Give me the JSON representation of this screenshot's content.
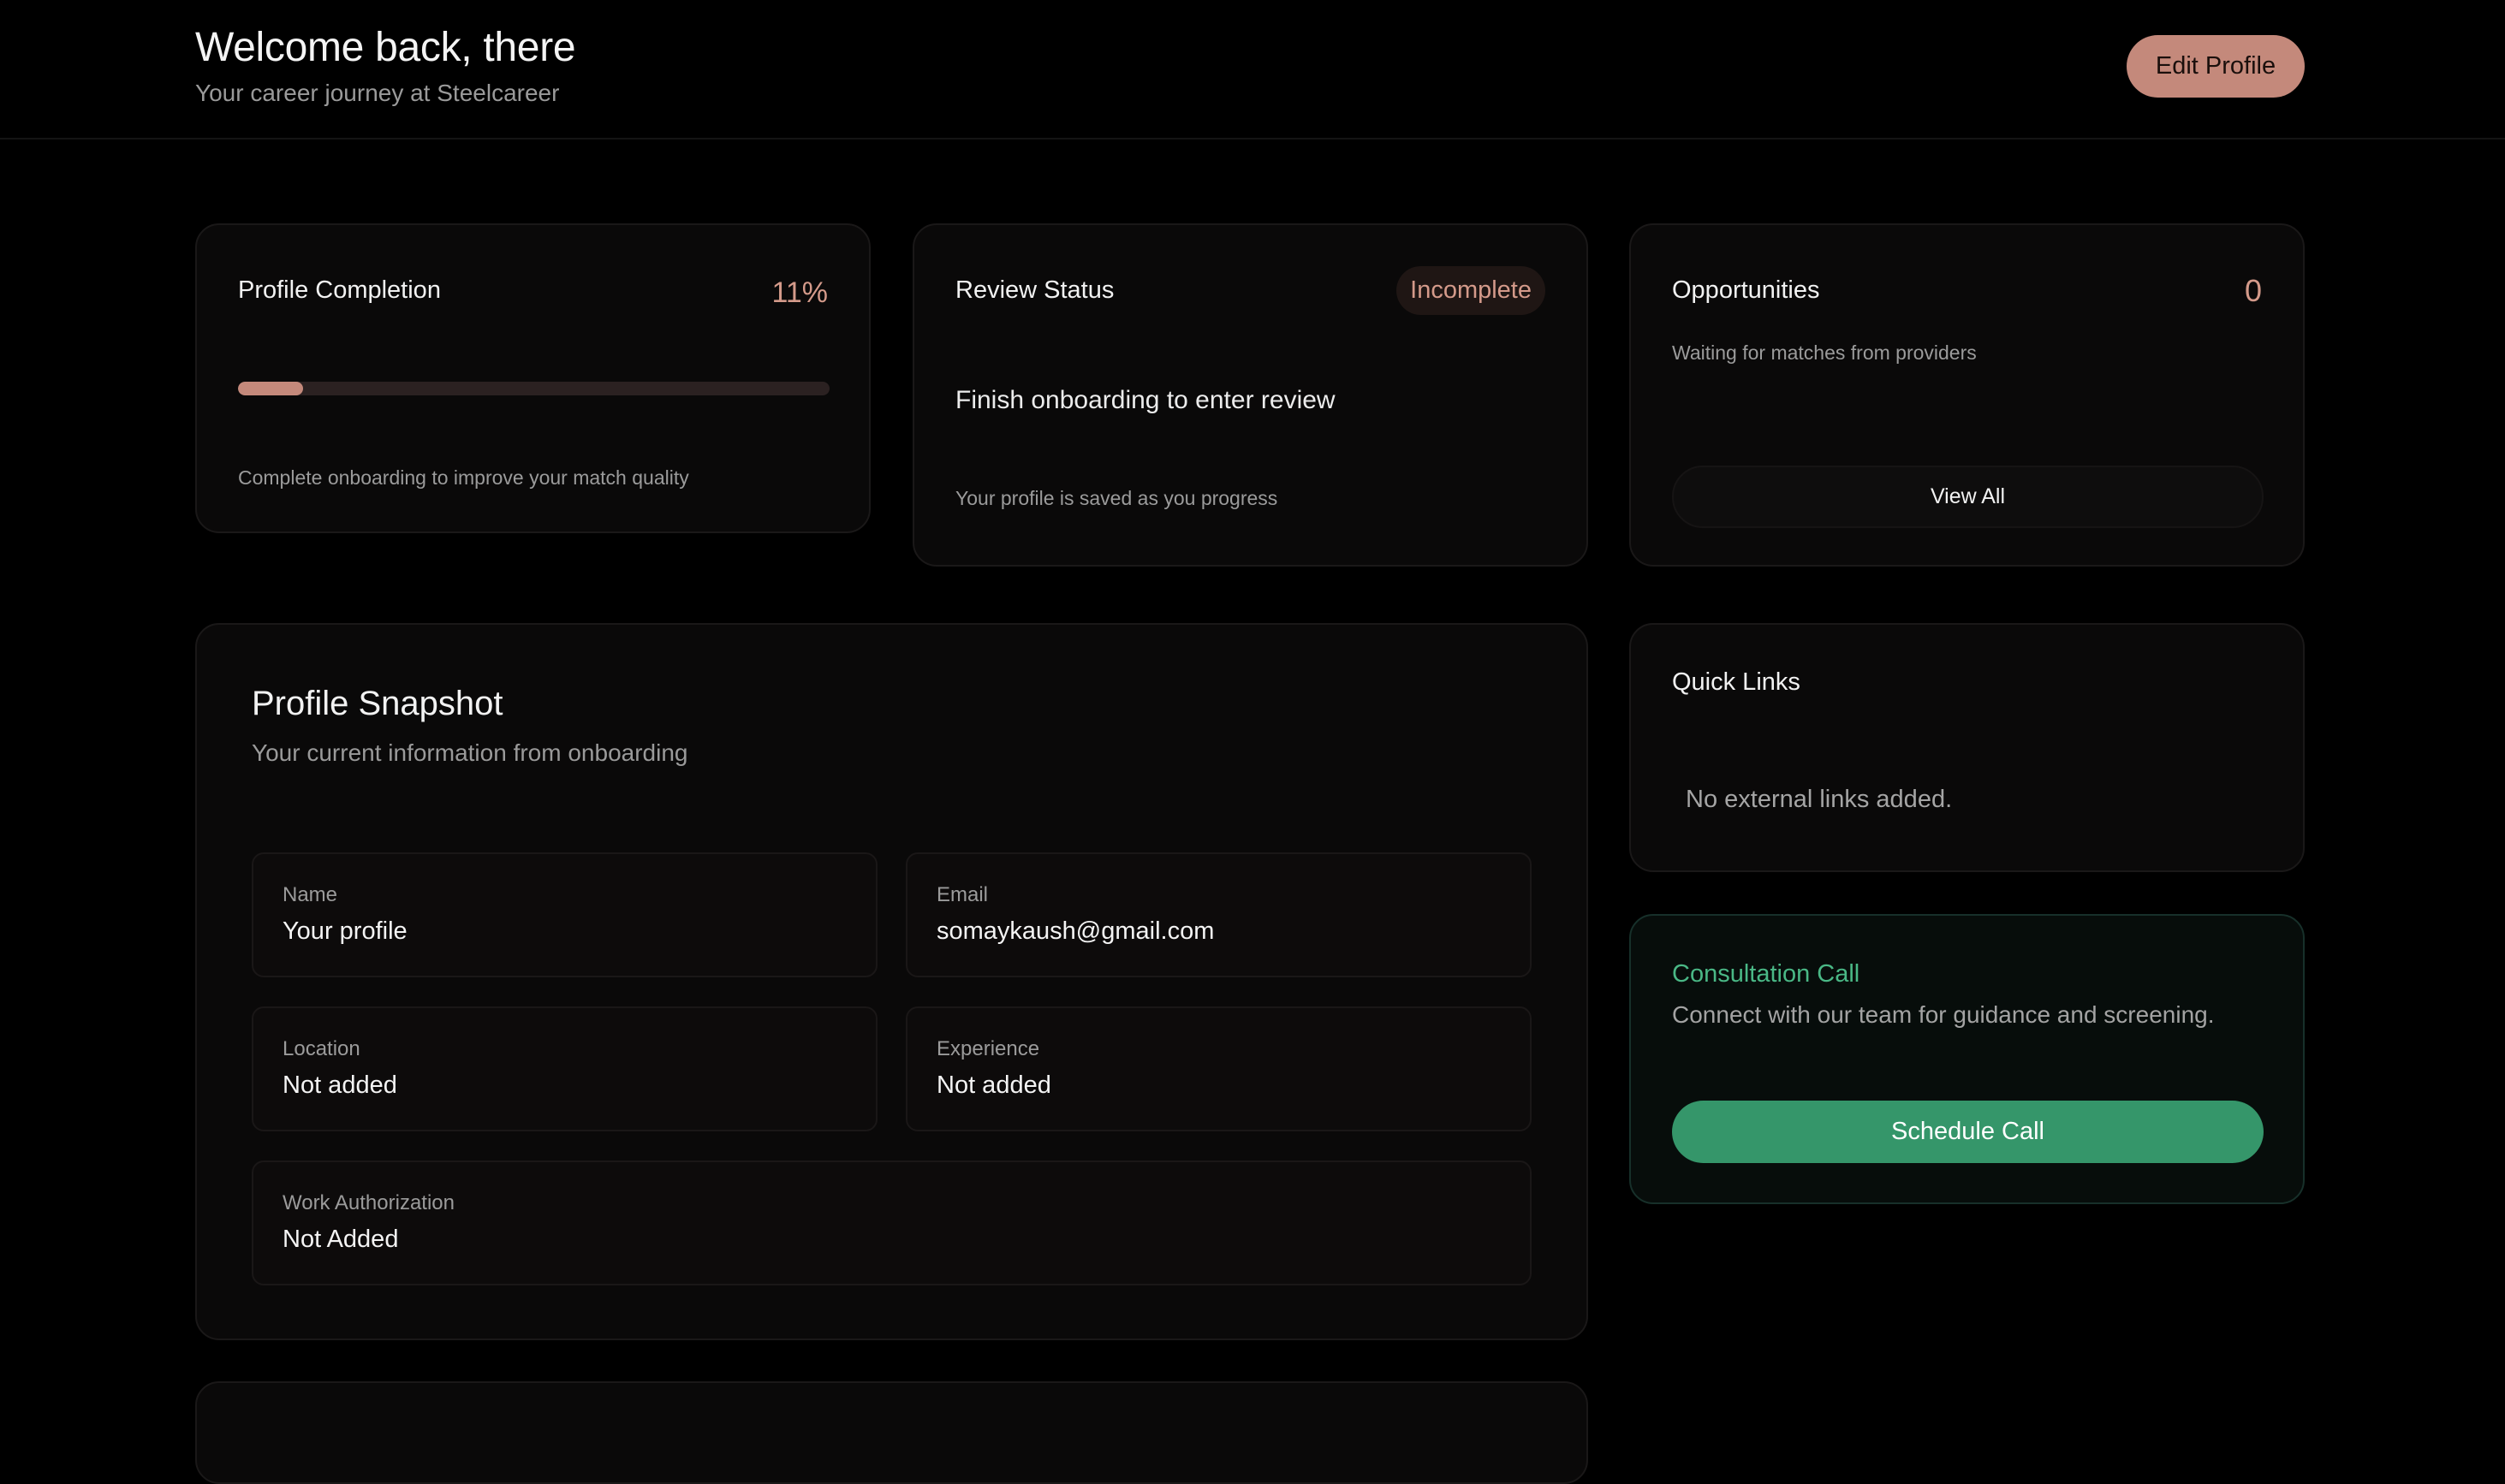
{
  "header": {
    "title": "Welcome back, there",
    "subtitle": "Your career journey at Steelcareer",
    "edit_profile_label": "Edit Profile"
  },
  "profile_completion": {
    "title": "Profile Completion",
    "value_label": "11%",
    "progress_fraction": 0.11,
    "hint": "Complete onboarding to improve your match quality"
  },
  "review_status": {
    "title": "Review Status",
    "badge": "Incomplete",
    "message": "Finish onboarding to enter review",
    "note": "Your profile is saved as you progress"
  },
  "opportunities": {
    "title": "Opportunities",
    "count": "0",
    "note": "Waiting for matches from providers",
    "view_all_label": "View All"
  },
  "profile_snapshot": {
    "title": "Profile Snapshot",
    "subtitle": "Your current information from onboarding",
    "fields": [
      {
        "label": "Name",
        "value": "Your profile"
      },
      {
        "label": "Email",
        "value": "somaykaush@gmail.com"
      },
      {
        "label": "Location",
        "value": "Not added"
      },
      {
        "label": "Experience",
        "value": "Not added"
      },
      {
        "label": "Work Authorization",
        "value": "Not Added"
      }
    ]
  },
  "quick_links": {
    "title": "Quick Links",
    "empty_text": "No external links added."
  },
  "consultation": {
    "title": "Consultation Call",
    "description": "Connect with our team for guidance and screening.",
    "button_label": "Schedule Call"
  },
  "colors": {
    "background": "#000000",
    "accent": "#c4897b",
    "accent_text": "#d49a8a",
    "success": "#35966a",
    "success_text": "#4ab886"
  }
}
